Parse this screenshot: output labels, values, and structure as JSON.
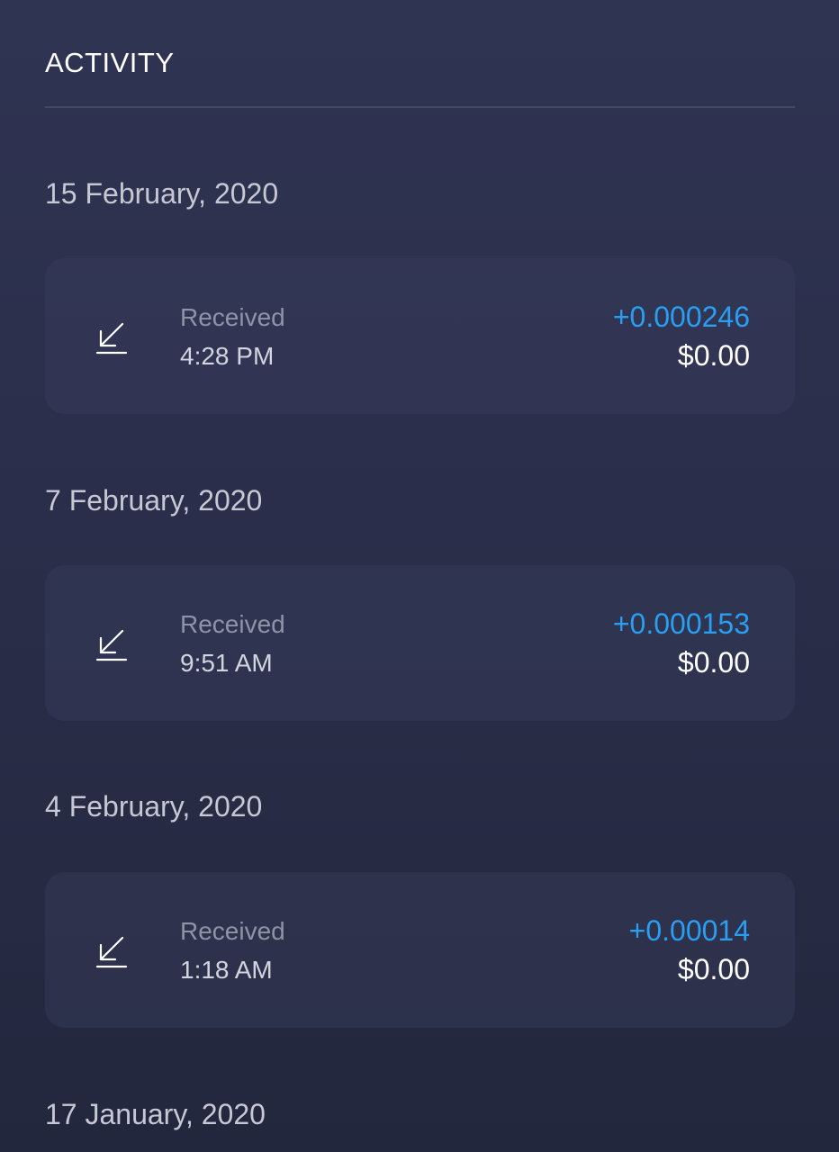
{
  "header": {
    "title": "ACTIVITY"
  },
  "groups": [
    {
      "date": "15 February, 2020",
      "transactions": [
        {
          "icon": "receive-arrow-icon",
          "type": "Received",
          "time": "4:28 PM",
          "amount": "+0.000246",
          "fiat": "$0.00"
        }
      ]
    },
    {
      "date": "7 February, 2020",
      "transactions": [
        {
          "icon": "receive-arrow-icon",
          "type": "Received",
          "time": "9:51 AM",
          "amount": "+0.000153",
          "fiat": "$0.00"
        }
      ]
    },
    {
      "date": "4 February, 2020",
      "transactions": [
        {
          "icon": "receive-arrow-icon",
          "type": "Received",
          "time": "1:18 AM",
          "amount": "+0.00014",
          "fiat": "$0.00"
        }
      ]
    },
    {
      "date": "17 January, 2020",
      "transactions": []
    }
  ],
  "colors": {
    "amount_positive": "#2a9ef1",
    "background_top": "#2f3452",
    "background_bottom": "#23273d",
    "card_background": "#30344f"
  }
}
